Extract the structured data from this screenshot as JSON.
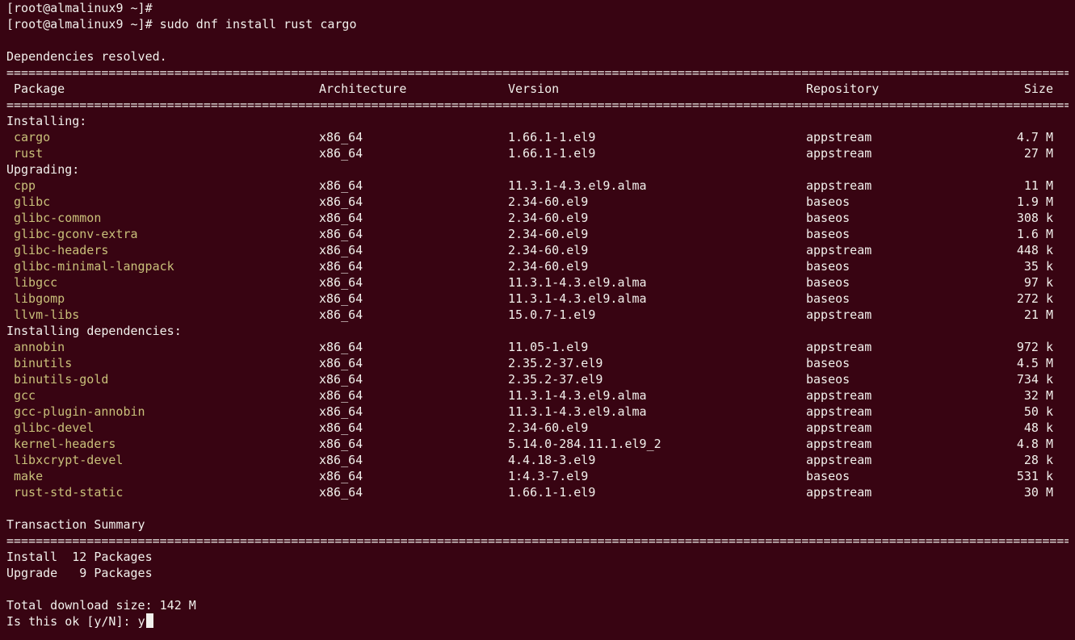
{
  "prompts": [
    "[root@almalinux9 ~]# ",
    "[root@almalinux9 ~]# sudo dnf install rust cargo"
  ],
  "status": "Dependencies resolved.",
  "rule": "==============================================================================================================================================================",
  "headers": {
    "package": "Package",
    "arch": "Architecture",
    "version": "Version",
    "repo": "Repository",
    "size": "Size"
  },
  "sections": [
    {
      "title": "Installing:",
      "packages": [
        {
          "name": "cargo",
          "arch": "x86_64",
          "version": "1.66.1-1.el9",
          "repo": "appstream",
          "size": "4.7 M"
        },
        {
          "name": "rust",
          "arch": "x86_64",
          "version": "1.66.1-1.el9",
          "repo": "appstream",
          "size": "27 M"
        }
      ]
    },
    {
      "title": "Upgrading:",
      "packages": [
        {
          "name": "cpp",
          "arch": "x86_64",
          "version": "11.3.1-4.3.el9.alma",
          "repo": "appstream",
          "size": "11 M"
        },
        {
          "name": "glibc",
          "arch": "x86_64",
          "version": "2.34-60.el9",
          "repo": "baseos",
          "size": "1.9 M"
        },
        {
          "name": "glibc-common",
          "arch": "x86_64",
          "version": "2.34-60.el9",
          "repo": "baseos",
          "size": "308 k"
        },
        {
          "name": "glibc-gconv-extra",
          "arch": "x86_64",
          "version": "2.34-60.el9",
          "repo": "baseos",
          "size": "1.6 M"
        },
        {
          "name": "glibc-headers",
          "arch": "x86_64",
          "version": "2.34-60.el9",
          "repo": "appstream",
          "size": "448 k"
        },
        {
          "name": "glibc-minimal-langpack",
          "arch": "x86_64",
          "version": "2.34-60.el9",
          "repo": "baseos",
          "size": "35 k"
        },
        {
          "name": "libgcc",
          "arch": "x86_64",
          "version": "11.3.1-4.3.el9.alma",
          "repo": "baseos",
          "size": "97 k"
        },
        {
          "name": "libgomp",
          "arch": "x86_64",
          "version": "11.3.1-4.3.el9.alma",
          "repo": "baseos",
          "size": "272 k"
        },
        {
          "name": "llvm-libs",
          "arch": "x86_64",
          "version": "15.0.7-1.el9",
          "repo": "appstream",
          "size": "21 M"
        }
      ]
    },
    {
      "title": "Installing dependencies:",
      "packages": [
        {
          "name": "annobin",
          "arch": "x86_64",
          "version": "11.05-1.el9",
          "repo": "appstream",
          "size": "972 k"
        },
        {
          "name": "binutils",
          "arch": "x86_64",
          "version": "2.35.2-37.el9",
          "repo": "baseos",
          "size": "4.5 M"
        },
        {
          "name": "binutils-gold",
          "arch": "x86_64",
          "version": "2.35.2-37.el9",
          "repo": "baseos",
          "size": "734 k"
        },
        {
          "name": "gcc",
          "arch": "x86_64",
          "version": "11.3.1-4.3.el9.alma",
          "repo": "appstream",
          "size": "32 M"
        },
        {
          "name": "gcc-plugin-annobin",
          "arch": "x86_64",
          "version": "11.3.1-4.3.el9.alma",
          "repo": "appstream",
          "size": "50 k"
        },
        {
          "name": "glibc-devel",
          "arch": "x86_64",
          "version": "2.34-60.el9",
          "repo": "appstream",
          "size": "48 k"
        },
        {
          "name": "kernel-headers",
          "arch": "x86_64",
          "version": "5.14.0-284.11.1.el9_2",
          "repo": "appstream",
          "size": "4.8 M"
        },
        {
          "name": "libxcrypt-devel",
          "arch": "x86_64",
          "version": "4.4.18-3.el9",
          "repo": "appstream",
          "size": "28 k"
        },
        {
          "name": "make",
          "arch": "x86_64",
          "version": "1:4.3-7.el9",
          "repo": "baseos",
          "size": "531 k"
        },
        {
          "name": "rust-std-static",
          "arch": "x86_64",
          "version": "1.66.1-1.el9",
          "repo": "appstream",
          "size": "30 M"
        }
      ]
    }
  ],
  "summary": {
    "title": "Transaction Summary",
    "install": "Install  12 Packages",
    "upgrade": "Upgrade   9 Packages",
    "download": "Total download size: 142 M",
    "question": "Is this ok [y/N]: ",
    "answer": "y"
  },
  "colors": {
    "background": "#380412",
    "text": "#f2f0ec",
    "package_name": "#c9c07a"
  }
}
